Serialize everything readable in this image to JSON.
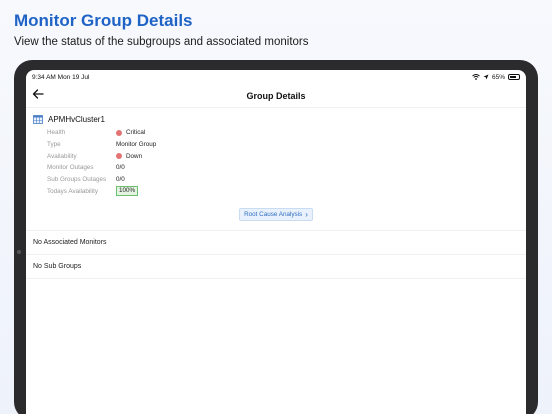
{
  "promo": {
    "title": "Monitor Group Details",
    "subtitle": "View the status of the subgroups and associated monitors"
  },
  "status_bar": {
    "time_date": "9:34 AM  Mon 19 Jul",
    "battery": "65%"
  },
  "nav": {
    "title": "Group Details",
    "back_icon": "arrow-left-icon"
  },
  "group": {
    "name": "APMHvCluster1",
    "icon": "grid-table-icon",
    "rows": [
      {
        "label": "Health",
        "value": "Critical",
        "dot_color": "#e57373"
      },
      {
        "label": "Type",
        "value": "Monitor Group"
      },
      {
        "label": "Availability",
        "value": "Down",
        "dot_color": "#e57373"
      },
      {
        "label": "Monitor Outages",
        "value": "0/0"
      },
      {
        "label": "Sub Groups Outages",
        "value": "0/0"
      },
      {
        "label": "Todays Availability",
        "value": "100%",
        "badge_color": "#e3f4e3"
      }
    ]
  },
  "actions": {
    "root_cause": "Root Cause Analysis"
  },
  "sections": {
    "monitors": "No Associated Monitors",
    "subgroups": "No Sub Groups"
  },
  "colors": {
    "accent": "#1f63c6",
    "critical": "#e57373",
    "link": "#2d6cc0"
  }
}
